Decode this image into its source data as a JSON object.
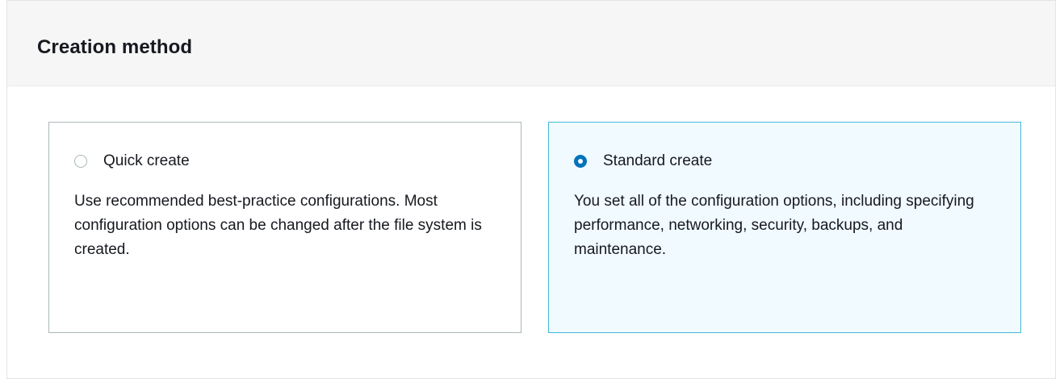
{
  "section": {
    "title": "Creation method"
  },
  "options": [
    {
      "label": "Quick create",
      "description": "Use recommended best-practice configurations. Most configuration options can be changed after the file system is created.",
      "selected": false
    },
    {
      "label": "Standard create",
      "description": "You set all of the configuration options, including specifying performance, networking, security, backups, and maintenance.",
      "selected": true
    }
  ],
  "colors": {
    "selected_border": "#44b9d6",
    "selected_background": "#f1faff",
    "radio_selected": "#0073bb",
    "tile_border": "#aab7b8",
    "header_background": "#f6f6f6"
  }
}
